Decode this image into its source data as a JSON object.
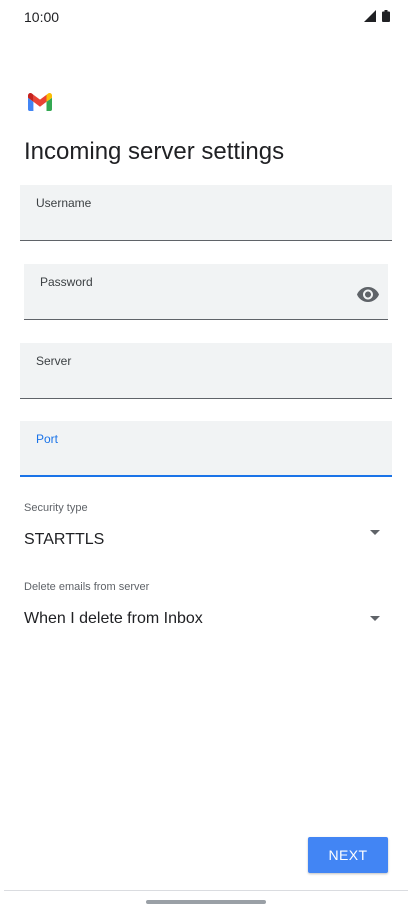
{
  "status_bar": {
    "time": "10:00",
    "icons": [
      "signal-icon",
      "battery-icon"
    ]
  },
  "app": {
    "logo": "gmail-logo",
    "brand_colors": [
      "#ea4335",
      "#34a853",
      "#4285f4",
      "#fbbc04",
      "#c5221f"
    ]
  },
  "page": {
    "title": "Incoming server settings"
  },
  "fields": {
    "username": {
      "label": "Username",
      "value": ""
    },
    "password": {
      "label": "Password",
      "value": "",
      "toggle_icon": "eye-icon"
    },
    "server": {
      "label": "Server",
      "value": ""
    },
    "port": {
      "label": "Port",
      "value": "",
      "focused": true
    }
  },
  "security_type": {
    "label": "Security type",
    "value": "STARTTLS"
  },
  "delete_emails": {
    "label": "Delete emails from server",
    "value": "When I delete from Inbox"
  },
  "actions": {
    "next_label": "NEXT"
  },
  "colors": {
    "accent": "#4285f4",
    "focus": "#1a73e8",
    "field_bg": "#f1f3f4"
  }
}
